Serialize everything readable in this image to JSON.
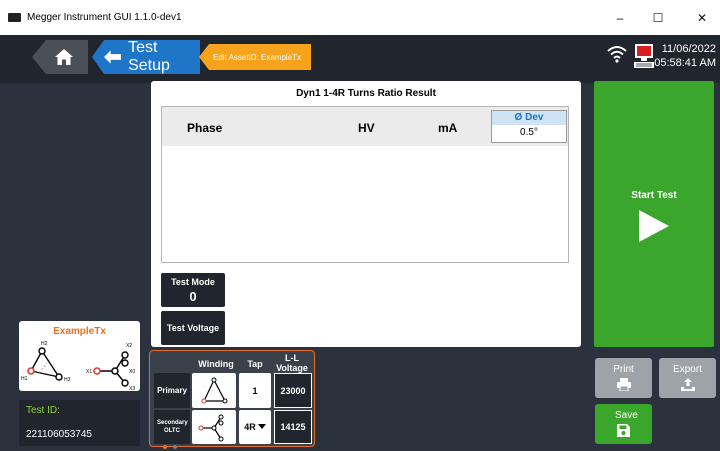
{
  "window": {
    "title": "Megger Instrument GUI 1.1.0-dev1",
    "minimize_glyph": "–",
    "maximize_glyph": "☐",
    "close_glyph": "✕"
  },
  "header": {
    "home_icon": "home-icon",
    "back_label": "Test Setup",
    "asset_tab_label": "Edit AssetID: ExampleTx",
    "date": "11/06/2022",
    "time": "05:58:41 AM"
  },
  "asset": {
    "name": "ExampleTx",
    "primary_terminals": [
      "H2",
      "H1",
      "H3"
    ],
    "secondary_terminals": [
      "X2",
      "X1",
      "X0",
      "X3"
    ]
  },
  "test_id": {
    "label": "Test ID:",
    "value": "221106053745"
  },
  "result": {
    "title": "Dyn1 1-4R Turns Ratio Result",
    "columns": [
      "Phase",
      "HV",
      "mA"
    ],
    "deviation": {
      "label": "Ø Dev",
      "value": "0.5°"
    }
  },
  "test_mode": {
    "label": "Test Mode",
    "value": "0"
  },
  "test_voltage": {
    "label": "Test Voltage"
  },
  "winding_table": {
    "headers": {
      "winding": "Winding",
      "tap": "Tap",
      "voltage": "L-L Voltage"
    },
    "rows": [
      {
        "label": "Primary",
        "tap": "1",
        "voltage": "23000"
      },
      {
        "label": "Secondary OLTC",
        "tap": "4R",
        "voltage": "14125"
      }
    ]
  },
  "actions": {
    "start_test": "Start Test",
    "print": "Print",
    "export": "Export",
    "save": "Save"
  },
  "colors": {
    "accent_blue": "#1f75c8",
    "accent_orange": "#f6a21b",
    "start_green": "#3aa62c",
    "label_green": "#8fd13a",
    "asset_name_orange": "#f0701c"
  }
}
